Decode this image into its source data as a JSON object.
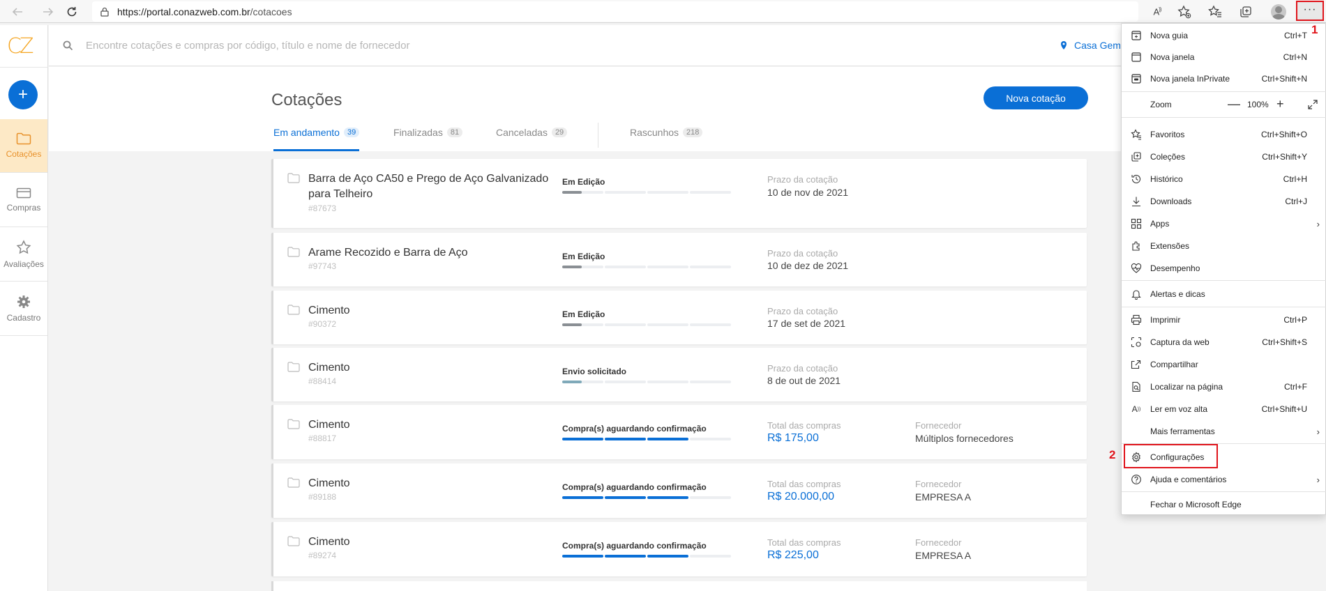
{
  "browser": {
    "url_host": "https://portal.conazweb.com.br",
    "url_path": "/cotacoes"
  },
  "app": {
    "logo": "CZ",
    "search_placeholder": "Encontre cotações e compras por código, título e nome de fornecedor",
    "location_label": "Casa Gemi",
    "sidebar": {
      "add_label": "+",
      "items": [
        {
          "label": "Cotações",
          "icon": "folder-icon"
        },
        {
          "label": "Compras",
          "icon": "card-icon"
        },
        {
          "label": "Avaliações",
          "icon": "star-icon"
        },
        {
          "label": "Cadastro",
          "icon": "gear-icon"
        }
      ]
    },
    "page_title": "Cotações",
    "new_button": "Nova cotação",
    "tabs": [
      {
        "label": "Em andamento",
        "count": "39"
      },
      {
        "label": "Finalizadas",
        "count": "81"
      },
      {
        "label": "Canceladas",
        "count": "29"
      },
      {
        "label": "Rascunhos",
        "count": "218"
      }
    ],
    "cards": [
      {
        "title": "Barra de Aço CA50 e Prego de Aço Galvanizado para Telheiro",
        "code": "#87673",
        "status": "Em Edição",
        "progress_steps": 0.5,
        "progress_color": "#8a8f94",
        "label1": "Prazo da cotação",
        "value1": "10 de nov de 2021",
        "label2": "",
        "value2": ""
      },
      {
        "title": "Arame Recozido e Barra de Aço",
        "code": "#97743",
        "status": "Em Edição",
        "progress_steps": 0.5,
        "progress_color": "#8a8f94",
        "label1": "Prazo da cotação",
        "value1": "10 de dez de 2021",
        "label2": "",
        "value2": ""
      },
      {
        "title": "Cimento",
        "code": "#90372",
        "status": "Em Edição",
        "progress_steps": 0.5,
        "progress_color": "#8a8f94",
        "label1": "Prazo da cotação",
        "value1": "17 de set de 2021",
        "label2": "",
        "value2": ""
      },
      {
        "title": "Cimento",
        "code": "#88414",
        "status": "Envio solicitado",
        "progress_steps": 0.5,
        "progress_color": "#7fa9b9",
        "label1": "Prazo da cotação",
        "value1": "8 de out de 2021",
        "label2": "",
        "value2": ""
      },
      {
        "title": "Cimento",
        "code": "#88817",
        "status": "Compra(s) aguardando confirmação",
        "progress_steps": 3,
        "progress_color": "#0a6fd6",
        "label1": "Total das compras",
        "value1": "R$ 175,00",
        "label2": "Fornecedor",
        "value2": "Múltiplos fornecedores"
      },
      {
        "title": "Cimento",
        "code": "#89188",
        "status": "Compra(s) aguardando confirmação",
        "progress_steps": 3,
        "progress_color": "#0a6fd6",
        "label1": "Total das compras",
        "value1": "R$ 20.000,00",
        "label2": "Fornecedor",
        "value2": "EMPRESA A"
      },
      {
        "title": "Cimento",
        "code": "#89274",
        "status": "Compra(s) aguardando confirmação",
        "progress_steps": 3,
        "progress_color": "#0a6fd6",
        "label1": "Total das compras",
        "value1": "R$ 225,00",
        "label2": "Fornecedor",
        "value2": "EMPRESA A"
      }
    ]
  },
  "edge_menu": {
    "items": [
      {
        "label": "Nova guia",
        "shortcut": "Ctrl+T",
        "icon": "new-tab-icon"
      },
      {
        "label": "Nova janela",
        "shortcut": "Ctrl+N",
        "icon": "new-window-icon"
      },
      {
        "label": "Nova janela InPrivate",
        "shortcut": "Ctrl+Shift+N",
        "icon": "inprivate-icon"
      },
      {
        "label": "Zoom",
        "shortcut": "",
        "icon": ""
      },
      {
        "label": "Favoritos",
        "shortcut": "Ctrl+Shift+O",
        "icon": "favorites-icon"
      },
      {
        "label": "Coleções",
        "shortcut": "Ctrl+Shift+Y",
        "icon": "collections-icon"
      },
      {
        "label": "Histórico",
        "shortcut": "Ctrl+H",
        "icon": "history-icon"
      },
      {
        "label": "Downloads",
        "shortcut": "Ctrl+J",
        "icon": "download-icon"
      },
      {
        "label": "Apps",
        "shortcut": "",
        "icon": "apps-icon"
      },
      {
        "label": "Extensões",
        "shortcut": "",
        "icon": "extensions-icon"
      },
      {
        "label": "Desempenho",
        "shortcut": "",
        "icon": "performance-icon"
      },
      {
        "label": "Alertas e dicas",
        "shortcut": "",
        "icon": "bell-icon"
      },
      {
        "label": "Imprimir",
        "shortcut": "Ctrl+P",
        "icon": "print-icon"
      },
      {
        "label": "Captura da web",
        "shortcut": "Ctrl+Shift+S",
        "icon": "web-capture-icon"
      },
      {
        "label": "Compartilhar",
        "shortcut": "",
        "icon": "share-icon"
      },
      {
        "label": "Localizar na página",
        "shortcut": "Ctrl+F",
        "icon": "find-icon"
      },
      {
        "label": "Ler em voz alta",
        "shortcut": "Ctrl+Shift+U",
        "icon": "read-aloud-icon"
      },
      {
        "label": "Mais ferramentas",
        "shortcut": "",
        "icon": ""
      },
      {
        "label": "Configurações",
        "shortcut": "",
        "icon": "settings-icon"
      },
      {
        "label": "Ajuda e comentários",
        "shortcut": "",
        "icon": "help-icon"
      },
      {
        "label": "Fechar o Microsoft Edge",
        "shortcut": "",
        "icon": ""
      }
    ],
    "zoom_value": "100%",
    "zoom_minus": "—",
    "zoom_plus": "+"
  },
  "annotations": {
    "callout_1": "1",
    "callout_2": "2"
  },
  "colors": {
    "accent": "#0a6fd6",
    "brand_orange": "#f5a623",
    "highlight_red": "#e0141b"
  }
}
